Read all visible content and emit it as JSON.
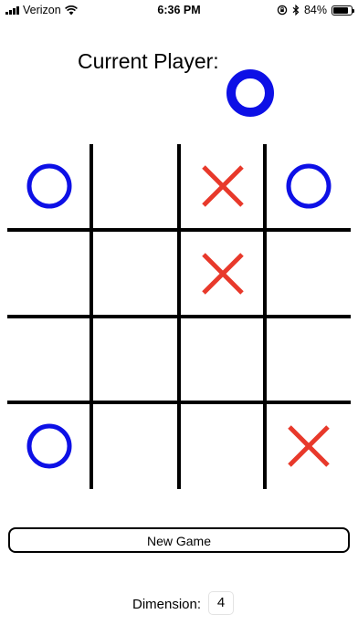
{
  "status_bar": {
    "carrier": "Verizon",
    "time": "6:36 PM",
    "battery_text": "84%",
    "battery_level": 0.84,
    "icons": [
      "signal-icon",
      "wifi-icon",
      "orientation-lock-icon",
      "bluetooth-icon",
      "battery-icon"
    ]
  },
  "header": {
    "label": "Current Player:",
    "current_player": "O"
  },
  "board": {
    "dimension": 4,
    "cells": [
      [
        "O",
        "",
        "X",
        "O"
      ],
      [
        "",
        "",
        "X",
        ""
      ],
      [
        "",
        "",
        "",
        ""
      ],
      [
        "O",
        "",
        "",
        "X"
      ]
    ]
  },
  "colors": {
    "o_mark": "#0d10e6",
    "x_mark": "#e8392b",
    "grid": "#000000"
  },
  "controls": {
    "new_game_label": "New Game",
    "dimension_label": "Dimension:",
    "dimension_value": "4"
  }
}
